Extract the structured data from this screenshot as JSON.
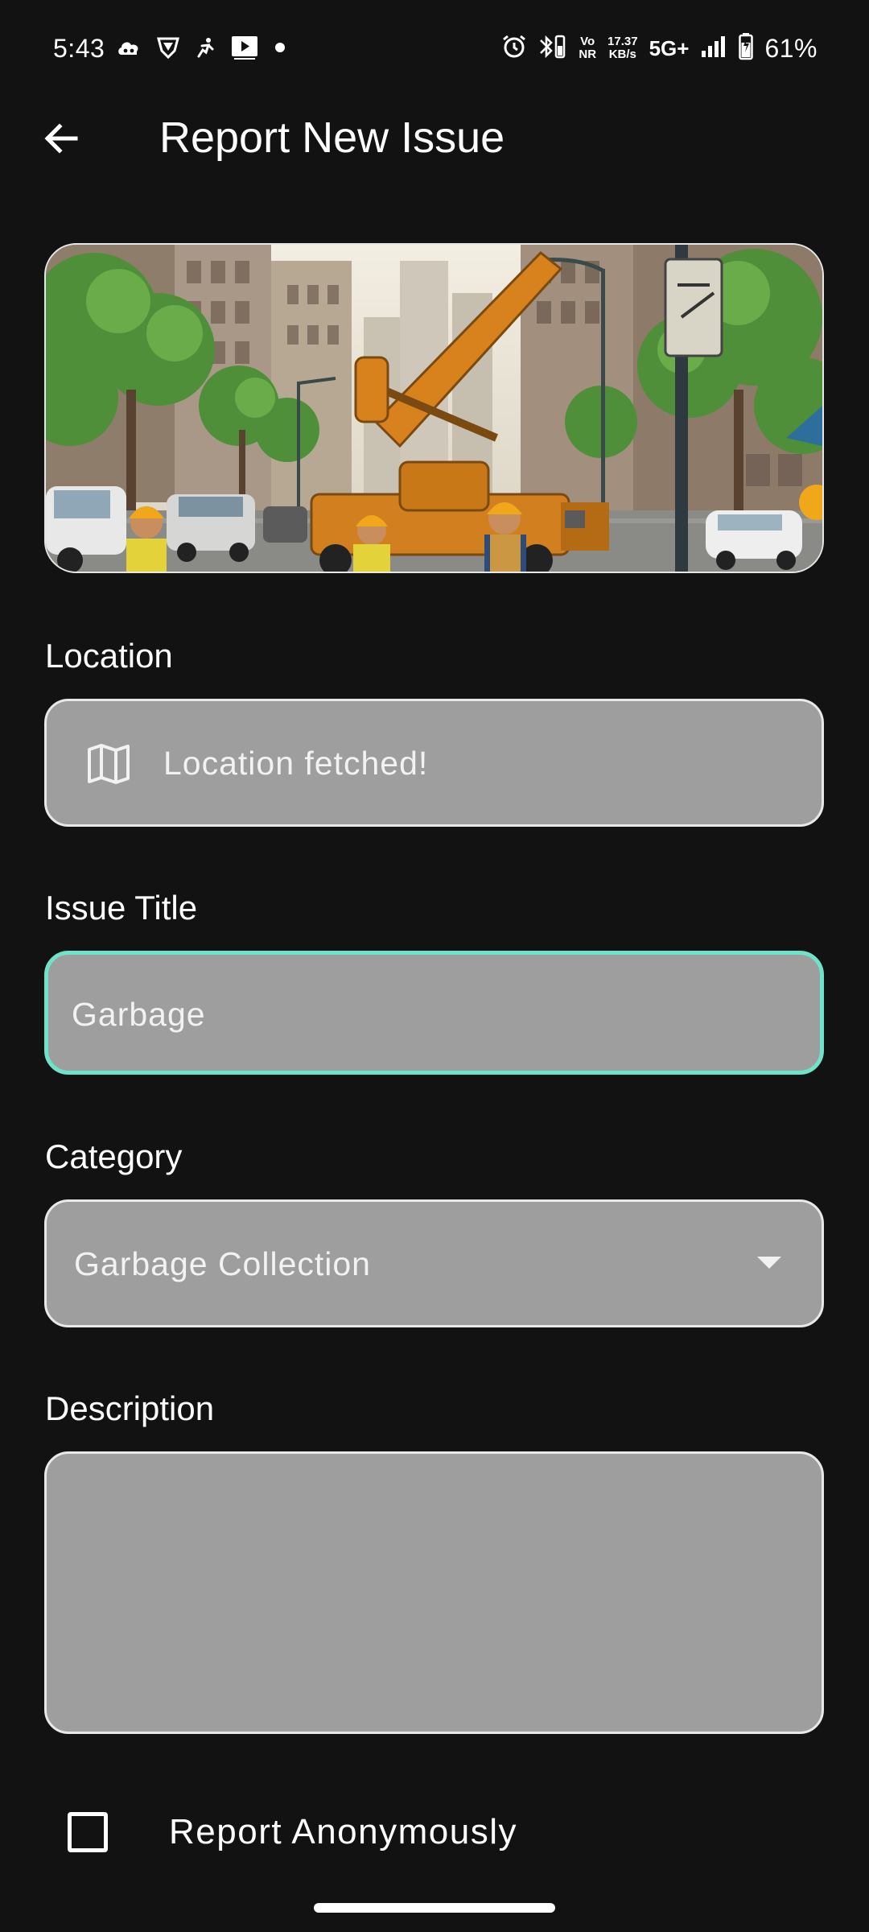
{
  "status_bar": {
    "time": "5:43",
    "left_icons": [
      "cloud-game-icon",
      "vpn-shield-icon",
      "activity-icon",
      "media-play-icon",
      "notification-dot-icon"
    ],
    "volte": [
      "Vo",
      "NR"
    ],
    "speed": [
      "17.37",
      "KB/s"
    ],
    "network": "5G+",
    "battery": "61%"
  },
  "app_bar": {
    "title": "Report New Issue",
    "back_icon": "arrow-back-icon"
  },
  "form": {
    "location": {
      "label": "Location",
      "value": "Location fetched!",
      "icon": "map-icon"
    },
    "title": {
      "label": "Issue Title",
      "value": "Garbage"
    },
    "category": {
      "label": "Category",
      "value": "Garbage Collection",
      "icon": "dropdown-arrow-icon"
    },
    "description": {
      "label": "Description",
      "value": ""
    },
    "anonymous": {
      "label": "Report Anonymously",
      "checked": false
    }
  },
  "colors": {
    "background": "#121212",
    "field_fill": "#9e9e9e",
    "focus_border": "#6fe3c9",
    "text": "#ffffff"
  }
}
